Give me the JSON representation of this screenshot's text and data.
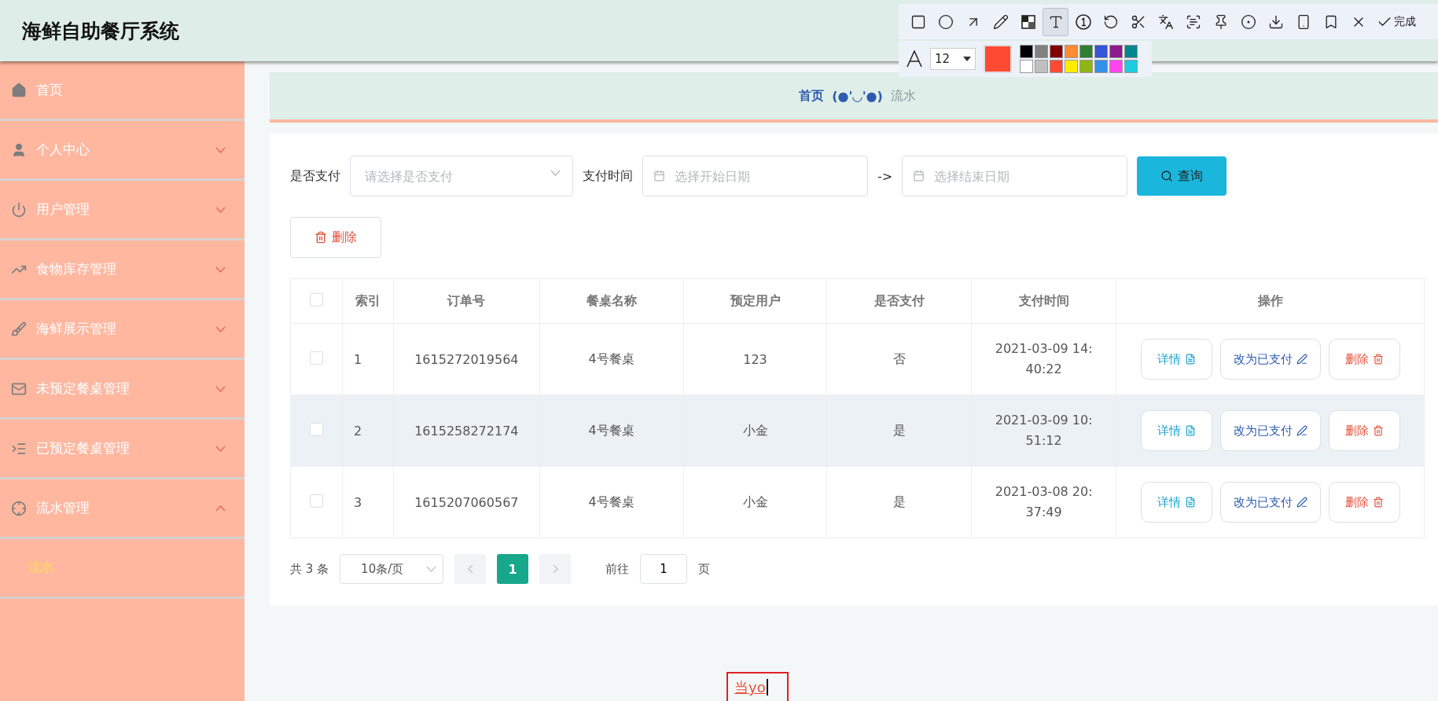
{
  "header": {
    "title": "海鲜自助餐厅系统"
  },
  "sidebar": {
    "items": [
      {
        "label": "首页",
        "kind": "link"
      },
      {
        "label": "个人中心",
        "kind": "submenu",
        "expanded": false
      },
      {
        "label": "用户管理",
        "kind": "submenu",
        "expanded": false
      },
      {
        "label": "食物库存管理",
        "kind": "submenu",
        "expanded": false
      },
      {
        "label": "海鲜展示管理",
        "kind": "submenu",
        "expanded": false
      },
      {
        "label": "未预定餐桌管理",
        "kind": "submenu",
        "expanded": false
      },
      {
        "label": "已预定餐桌管理",
        "kind": "submenu",
        "expanded": false
      },
      {
        "label": "流水管理",
        "kind": "submenu",
        "expanded": true,
        "children": [
          {
            "label": "流水",
            "selected": true
          }
        ]
      }
    ]
  },
  "breadcrumb": [
    {
      "label": "首页",
      "kind": "link"
    },
    {
      "label": "(●'◡'●)",
      "kind": "face"
    },
    {
      "label": "流水",
      "kind": "current"
    }
  ],
  "filters": {
    "paid_label": "是否支付",
    "paid_placeholder": "请选择是否支付",
    "time_label": "支付时间",
    "start_placeholder": "选择开始日期",
    "separator": "->",
    "end_placeholder": "选择结束日期",
    "search_button": "查询"
  },
  "delete_button": "删除",
  "table": {
    "columns": [
      "索引",
      "订单号",
      "餐桌名称",
      "预定用户",
      "是否支付",
      "支付时间",
      "操作"
    ],
    "header_checked": false,
    "rows": [
      {
        "checked": false,
        "hovered": false,
        "cells": [
          "1",
          "1615272019564",
          "4号餐桌",
          "123",
          "否",
          "2021-03-09 14:40:22"
        ],
        "actions": [
          {
            "label": "详情",
            "kind": "detail"
          },
          {
            "label": "改为已支付",
            "kind": "edit"
          },
          {
            "label": "删除",
            "kind": "delete"
          }
        ]
      },
      {
        "checked": false,
        "hovered": true,
        "cells": [
          "2",
          "1615258272174",
          "4号餐桌",
          "小金",
          "是",
          "2021-03-09 10:51:12"
        ],
        "actions": [
          {
            "label": "详情",
            "kind": "detail"
          },
          {
            "label": "改为已支付",
            "kind": "edit"
          },
          {
            "label": "删除",
            "kind": "delete"
          }
        ]
      },
      {
        "checked": false,
        "hovered": false,
        "cells": [
          "3",
          "1615207060567",
          "4号餐桌",
          "小金",
          "是",
          "2021-03-08 20:37:49"
        ],
        "actions": [
          {
            "label": "详情",
            "kind": "detail"
          },
          {
            "label": "改为已支付",
            "kind": "edit"
          },
          {
            "label": "删除",
            "kind": "delete"
          }
        ]
      }
    ]
  },
  "pagination": {
    "total": "共 3 条",
    "page_size": "10条/页",
    "prev_disabled": true,
    "next_disabled": true,
    "pages": [
      {
        "label": "1",
        "selected": true
      }
    ],
    "goto_label": "前往",
    "goto_value": "1",
    "goto_suffix": "页"
  },
  "capture_toolbar": {
    "tools": [
      {
        "kind": "rect",
        "selected": false
      },
      {
        "kind": "ellipse",
        "selected": false
      },
      {
        "kind": "arrow",
        "selected": false
      },
      {
        "kind": "pencil",
        "selected": false
      },
      {
        "kind": "mosaic",
        "selected": false
      },
      {
        "kind": "text",
        "selected": true
      },
      {
        "kind": "number",
        "selected": false
      },
      {
        "kind": "undo",
        "selected": false
      },
      {
        "kind": "cut",
        "selected": false
      },
      {
        "kind": "translate",
        "selected": false
      },
      {
        "kind": "ocr",
        "selected": false
      },
      {
        "kind": "pin",
        "selected": false
      },
      {
        "kind": "record",
        "selected": false
      },
      {
        "kind": "save",
        "selected": false
      },
      {
        "kind": "phone",
        "selected": false
      },
      {
        "kind": "bookmark",
        "selected": false
      },
      {
        "kind": "close",
        "selected": false
      },
      {
        "kind": "done",
        "selected": false
      }
    ],
    "done_label": "完成",
    "font_size": "12",
    "current_swatch": {
      "color": "#ff4a33"
    },
    "palette": [
      {
        "color": "#000000"
      },
      {
        "color": "#808080"
      },
      {
        "color": "#800000"
      },
      {
        "color": "#ff8c33"
      },
      {
        "color": "#2e7d32"
      },
      {
        "color": "#3355d6"
      },
      {
        "color": "#8e1a8e"
      },
      {
        "color": "#00868f"
      },
      {
        "color": "#ffffff"
      },
      {
        "color": "#c0c0c0"
      },
      {
        "color": "#ff4a33"
      },
      {
        "color": "#ffee00"
      },
      {
        "color": "#8fb512"
      },
      {
        "color": "#3390e8"
      },
      {
        "color": "#ff44f0"
      },
      {
        "color": "#1ecbe0"
      }
    ]
  },
  "annotation": {
    "text": "当yo"
  }
}
